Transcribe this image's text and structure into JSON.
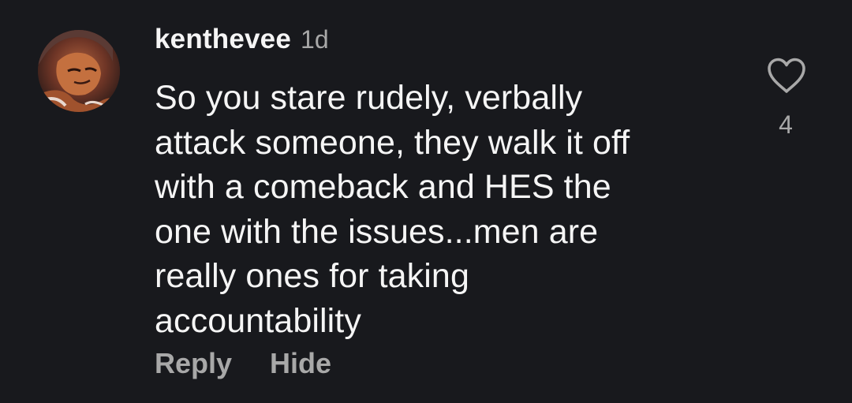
{
  "comment": {
    "username": "kenthevee",
    "timestamp": "1d",
    "text_lines": [
      "So you stare rudely, verbally",
      "attack someone, they walk it off",
      "with a comeback and HES the",
      "one with the issues...men are",
      "really ones for taking",
      "accountability"
    ],
    "like_count": "4",
    "actions": {
      "reply_label": "Reply",
      "hide_label": "Hide"
    },
    "icons": {
      "like": "heart-outline-icon",
      "avatar": "user-avatar"
    }
  },
  "colors": {
    "background": "#18191d",
    "primary_text": "#f5f5f5",
    "secondary_text": "#a8a8a8"
  }
}
